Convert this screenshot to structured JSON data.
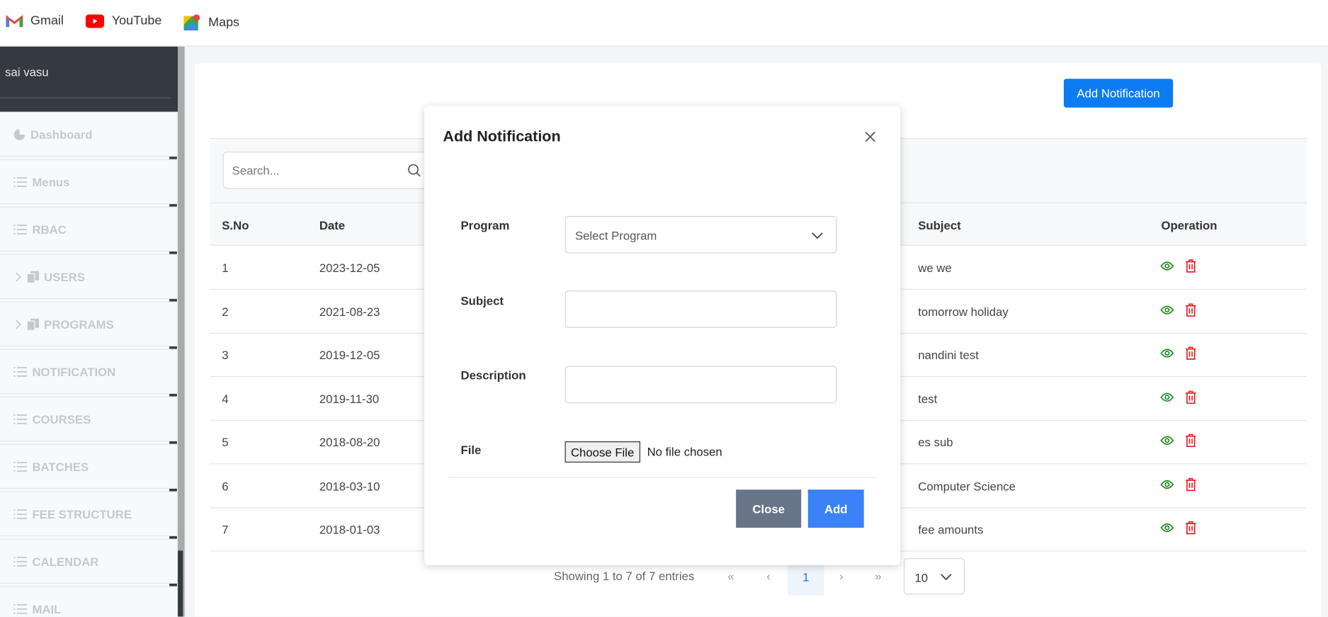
{
  "bookmarks": [
    {
      "label": "Gmail",
      "icon": "gmail-icon"
    },
    {
      "label": "YouTube",
      "icon": "youtube-icon"
    },
    {
      "label": "Maps",
      "icon": "maps-icon"
    }
  ],
  "sidebar": {
    "user": "sai vasu",
    "items": [
      {
        "label": "Dashboard",
        "icon": "pie-chart-icon"
      },
      {
        "label": "Menus",
        "icon": "list-icon"
      },
      {
        "label": "RBAC",
        "icon": "list-icon"
      },
      {
        "label": "USERS",
        "icon": "copy-icon",
        "expandable": true
      },
      {
        "label": "PROGRAMS",
        "icon": "copy-icon",
        "expandable": true
      },
      {
        "label": "NOTIFICATION",
        "icon": "list-icon"
      },
      {
        "label": "COURSES",
        "icon": "list-icon"
      },
      {
        "label": "BATCHES",
        "icon": "list-icon"
      },
      {
        "label": "FEE STRUCTURE",
        "icon": "list-icon"
      },
      {
        "label": "CALENDAR",
        "icon": "list-icon"
      },
      {
        "label": "MAIL",
        "icon": "list-icon"
      }
    ]
  },
  "main": {
    "add_button": "Add Notification",
    "search_placeholder": "Search...",
    "columns": [
      "S.No",
      "Date",
      "Subject",
      "Operation"
    ],
    "rows": [
      {
        "sno": "1",
        "date": "2023-12-05",
        "subject": "we we"
      },
      {
        "sno": "2",
        "date": "2021-08-23",
        "subject": "tomorrow holiday"
      },
      {
        "sno": "3",
        "date": "2019-12-05",
        "subject": "nandini test"
      },
      {
        "sno": "4",
        "date": "2019-11-30",
        "subject": "test"
      },
      {
        "sno": "5",
        "date": "2018-08-20",
        "subject": "es sub"
      },
      {
        "sno": "6",
        "date": "2018-03-10",
        "subject": "Computer Science"
      },
      {
        "sno": "7",
        "date": "2018-01-03",
        "subject": "fee amounts"
      }
    ],
    "pagination": {
      "info": "Showing 1 to 7 of 7 entries",
      "first": "«",
      "prev": "‹",
      "current": "1",
      "next": "›",
      "last": "»",
      "page_size": "10"
    }
  },
  "modal": {
    "title": "Add Notification",
    "program_label": "Program",
    "program_placeholder": "Select Program",
    "subject_label": "Subject",
    "description_label": "Description",
    "file_label": "File",
    "choose_file": "Choose File",
    "no_file": "No file chosen",
    "close": "Close",
    "add": "Add"
  },
  "colors": {
    "primary": "#0d7cf2",
    "add": "#3b82f6",
    "close": "#687589",
    "view": "#1e8a1e",
    "delete": "#ee1c25",
    "sidebar_dark": "#343a40"
  }
}
